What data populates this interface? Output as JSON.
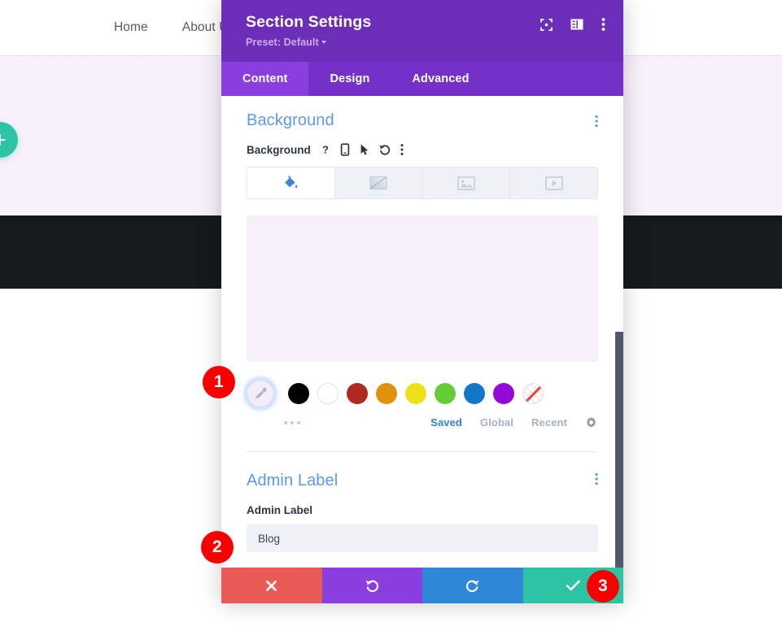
{
  "site": {
    "nav_links": [
      "Home",
      "About Us"
    ],
    "add_button_icon": "plus-icon"
  },
  "modal": {
    "title": "Section Settings",
    "preset_label": "Preset: Default",
    "header_icons": [
      "focus-expand-icon",
      "layout-panel-icon",
      "kebab-menu-icon"
    ],
    "tabs": [
      {
        "label": "Content",
        "active": true
      },
      {
        "label": "Design",
        "active": false
      },
      {
        "label": "Advanced",
        "active": false
      }
    ],
    "background_group": {
      "title": "Background",
      "group_menu_icon": "kebab-menu-icon",
      "field_label": "Background",
      "field_icons": [
        "help-icon",
        "responsive-mobile-icon",
        "hover-cursor-icon",
        "reset-undo-icon",
        "kebab-menu-icon"
      ],
      "bg_type_tabs": [
        {
          "icon": "paint-bucket-icon",
          "active": true
        },
        {
          "icon": "gradient-icon",
          "active": false
        },
        {
          "icon": "image-icon",
          "active": false
        },
        {
          "icon": "video-icon",
          "active": false
        }
      ],
      "preview_color": "#f7f0fb",
      "picker_icon": "eyedropper-icon",
      "swatches": [
        {
          "name": "black",
          "color": "#000000"
        },
        {
          "name": "white",
          "color": "#ffffff"
        },
        {
          "name": "dark-red",
          "color": "#b02a22"
        },
        {
          "name": "orange",
          "color": "#e0920c"
        },
        {
          "name": "yellow",
          "color": "#ede219"
        },
        {
          "name": "green",
          "color": "#66cc33"
        },
        {
          "name": "blue",
          "color": "#1277c4"
        },
        {
          "name": "purple",
          "color": "#9408d8"
        },
        {
          "name": "transparent",
          "color": "transparent"
        }
      ],
      "more_swatches_icon": "ellipsis-icon",
      "palette_tabs": [
        {
          "label": "Saved",
          "active": true
        },
        {
          "label": "Global",
          "active": false
        },
        {
          "label": "Recent",
          "active": false
        }
      ],
      "settings_icon": "gear-icon"
    },
    "admin_group": {
      "title": "Admin Label",
      "group_menu_icon": "kebab-menu-icon",
      "field_label": "Admin Label",
      "input_value": "Blog"
    },
    "footer_buttons": [
      {
        "name": "cancel",
        "icon": "close-x-icon",
        "color": "#e85a55"
      },
      {
        "name": "undo",
        "icon": "undo-icon",
        "color": "#8a3ee0"
      },
      {
        "name": "redo",
        "icon": "redo-icon",
        "color": "#2f87d8"
      },
      {
        "name": "save",
        "icon": "checkmark-icon",
        "color": "#2cc4a5"
      }
    ]
  },
  "annotations": [
    {
      "number": "1"
    },
    {
      "number": "2"
    },
    {
      "number": "3"
    }
  ]
}
